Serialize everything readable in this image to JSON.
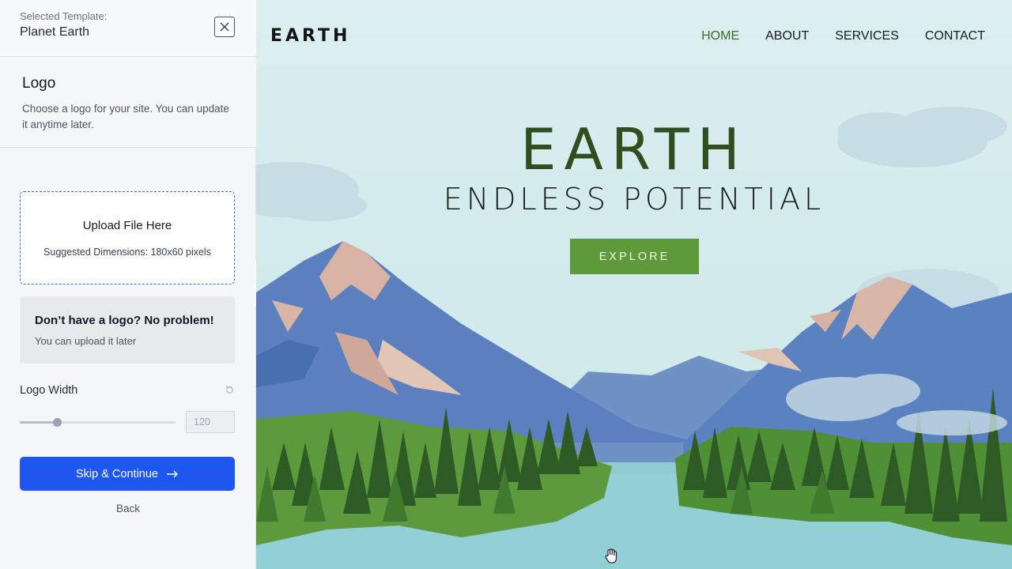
{
  "sidebar": {
    "selected_template_label": "Selected Template:",
    "selected_template_name": "Planet Earth",
    "section_title": "Logo",
    "section_description": "Choose a logo for your site. You can update it anytime later.",
    "upload_title": "Upload File Here",
    "upload_hint": "Suggested Dimensions: 180x60 pixels",
    "nologo_title": "Don’t have a logo? No problem!",
    "nologo_text": "You can upload it later",
    "logo_width_label": "Logo Width",
    "logo_width_value": "120",
    "logo_width_fraction": 0.24,
    "skip_button_label": "Skip & Continue",
    "back_label": "Back"
  },
  "preview": {
    "logo": "EARTH",
    "nav": [
      "HOME",
      "ABOUT",
      "SERVICES",
      "CONTACT"
    ],
    "hero_title": "EARTH",
    "hero_subtitle": "ENDLESS POTENTIAL",
    "cta_label": "EXPLORE"
  },
  "colors": {
    "accent": "#1d57f0",
    "brand_green": "#5f9a3a",
    "title_green": "#2f4f1e"
  }
}
